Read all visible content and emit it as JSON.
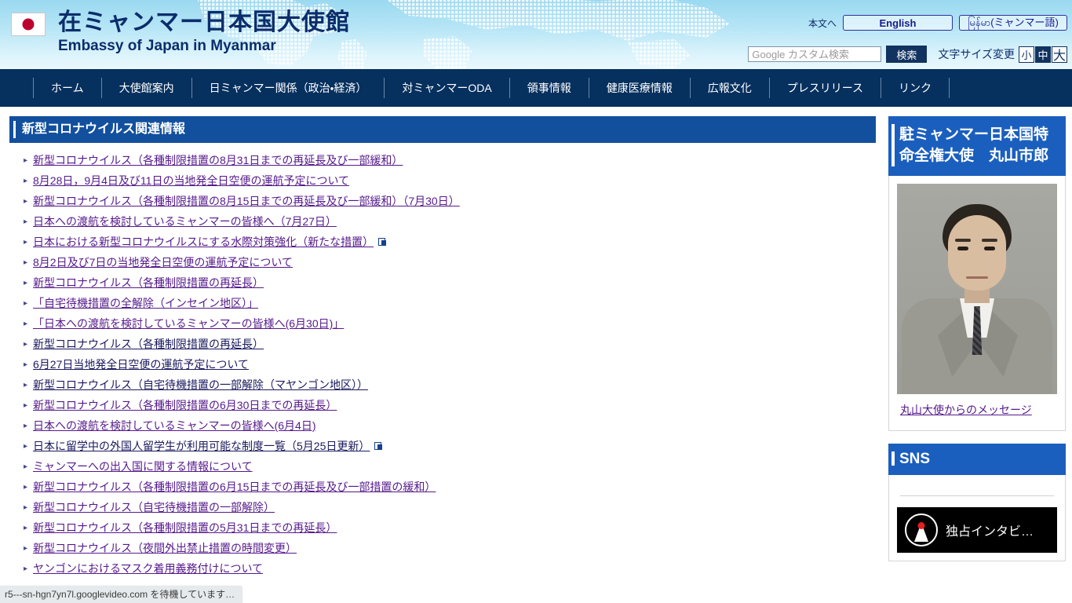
{
  "header": {
    "flag_alt": "japan-flag",
    "title_jp": "在ミャンマー日本国大使館",
    "title_en": "Embassy of Japan in Myanmar",
    "skip_link": "本文へ",
    "lang_english": "English",
    "lang_myanmar": "မြန်မာ(ミャンマー語)",
    "search_placeholder": "Google カスタム検索",
    "search_value": "",
    "search_button": "検索",
    "fontsize_label": "文字サイズ変更",
    "fontsize_small": "小",
    "fontsize_medium": "中",
    "fontsize_large": "大",
    "fontsize_active": "中"
  },
  "nav": {
    "items": [
      {
        "label": "ホーム"
      },
      {
        "label": "大使館案内"
      },
      {
        "label": "日ミャンマー関係（政治・経済）"
      },
      {
        "label": "対ミャンマーODA"
      },
      {
        "label": "領事情報"
      },
      {
        "label": "健康医療情報"
      },
      {
        "label": "広報文化"
      },
      {
        "label": "プレスリリース"
      },
      {
        "label": "リンク"
      }
    ]
  },
  "main": {
    "section_title": "新型コロナウイルス関連情報",
    "links": [
      {
        "label": "新型コロナウイルス（各種制限措置の8月31日までの再延長及び一部緩和）",
        "visited": true,
        "external": false
      },
      {
        "label": "8月28日，9月4日及び11日の当地発全日空便の運航予定について",
        "visited": true,
        "external": false
      },
      {
        "label": "新型コロナウイルス（各種制限措置の8月15日までの再延長及び一部緩和）（7月30日）",
        "visited": true,
        "external": false
      },
      {
        "label": "日本への渡航を検討しているミャンマーの皆様へ（7月27日）",
        "visited": true,
        "external": false
      },
      {
        "label": "日本における新型コロナウイルスにする水際対策強化（新たな措置）",
        "visited": true,
        "external": true
      },
      {
        "label": "8月2日及び7日の当地発全日空便の運航予定について",
        "visited": true,
        "external": false
      },
      {
        "label": "新型コロナウイルス（各種制限措置の再延長）",
        "visited": true,
        "external": false
      },
      {
        "label": "「自宅待機措置の全解除（インセイン地区）」",
        "visited": true,
        "external": false
      },
      {
        "label": "「日本への渡航を検討しているミャンマーの皆様へ(6月30日)」",
        "visited": true,
        "external": false
      },
      {
        "label": "新型コロナウイルス（各種制限措置の再延長）",
        "visited": false,
        "external": false
      },
      {
        "label": "6月27日当地発全日空便の運航予定について",
        "visited": false,
        "external": false
      },
      {
        "label": "新型コロナウイルス（自宅待機措置の一部解除（マヤンゴン地区））",
        "visited": false,
        "external": false
      },
      {
        "label": "新型コロナウイルス（各種制限措置の6月30日までの再延長）",
        "visited": true,
        "external": false
      },
      {
        "label": "日本への渡航を検討しているミャンマーの皆様へ(6月4日)",
        "visited": true,
        "external": false
      },
      {
        "label": "日本に留学中の外国人留学生が利用可能な制度一覧（5月25日更新）",
        "visited": false,
        "external": true
      },
      {
        "label": "ミャンマーへの出入国に関する情報について",
        "visited": true,
        "external": false
      },
      {
        "label": "新型コロナウイルス（各種制限措置の6月15日までの再延長及び一部措置の緩和）",
        "visited": true,
        "external": false
      },
      {
        "label": "新型コロナウイルス（自宅待機措置の一部解除）",
        "visited": true,
        "external": false
      },
      {
        "label": "新型コロナウイルス（各種制限措置の5月31日までの再延長）",
        "visited": true,
        "external": false
      },
      {
        "label": "新型コロナウイルス（夜間外出禁止措置の時間変更）",
        "visited": true,
        "external": false
      },
      {
        "label": "ヤンゴンにおけるマスク着用義務付けについて",
        "visited": true,
        "external": false
      }
    ]
  },
  "sidebar": {
    "ambassador": {
      "heading": "駐ミャンマー日本国特命全権大使　丸山市郎",
      "photo_alt": "ambassador-portrait",
      "message_link": "丸山大使からのメッセージ"
    },
    "sns": {
      "heading": "SNS",
      "video_title": "独占インタビ…",
      "video_logo_alt": "embassy-video-logo"
    }
  },
  "status": {
    "text": "r5---sn-hgn7yn7l.googlevideo.com を待機しています…"
  }
}
